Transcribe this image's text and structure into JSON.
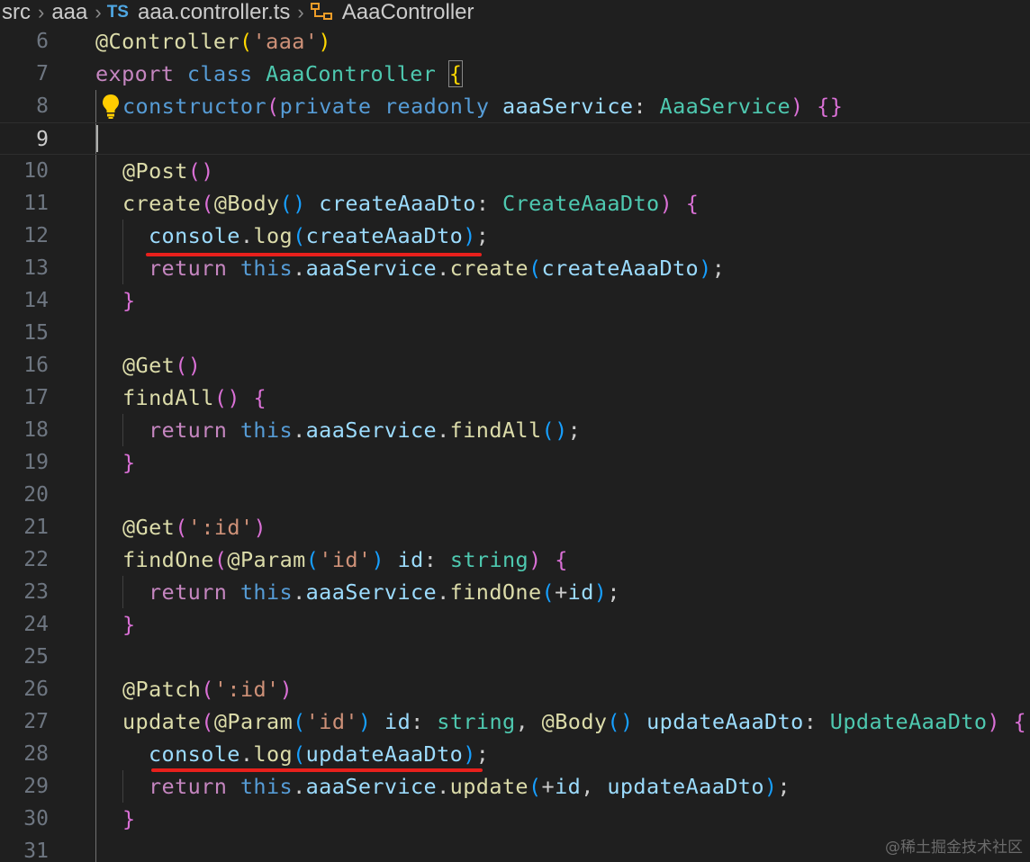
{
  "breadcrumb": {
    "folder1": "src",
    "folder2": "aaa",
    "file_icon": "TS",
    "file": "aaa.controller.ts",
    "symbol": "AaaController"
  },
  "editor": {
    "line_numbers": [
      "6",
      "7",
      "8",
      "9",
      "10",
      "11",
      "12",
      "13",
      "14",
      "15",
      "16",
      "17",
      "18",
      "19",
      "20",
      "21",
      "22",
      "23",
      "24",
      "25",
      "26",
      "27",
      "28",
      "29",
      "30",
      "31"
    ],
    "current_line": "9"
  },
  "watermark": "@稀土掘金技术社区",
  "colors": {
    "background": "#1f1f1f",
    "keyword": "#c586c0",
    "storage": "#569cd6",
    "variable": "#9cdcfe",
    "function": "#dcdcaa",
    "type": "#4ec9b0",
    "string": "#ce9178",
    "annotation_underline": "#e8201c"
  }
}
